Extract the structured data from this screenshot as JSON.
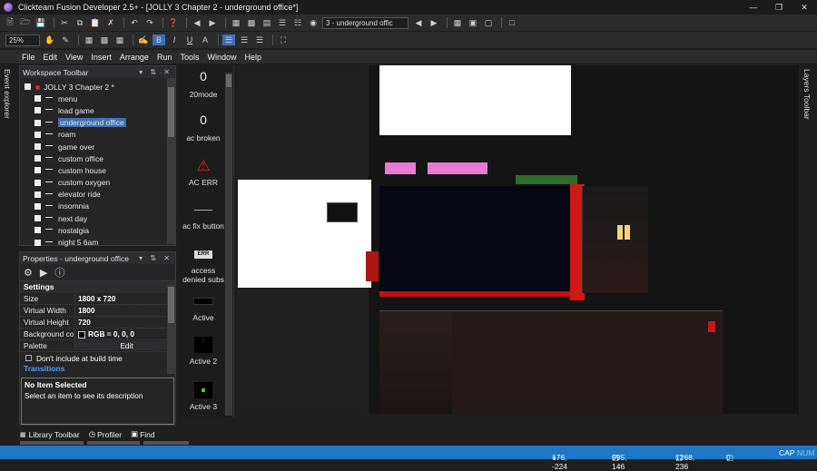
{
  "window": {
    "title": "Clickteam Fusion Developer 2.5+ - [JOLLY 3 Chapter 2 - underground office*]"
  },
  "toolbar": {
    "zoom": "25%",
    "frame_combo": "3 - underground offic"
  },
  "menu": [
    "File",
    "Edit",
    "View",
    "Insert",
    "Arrange",
    "Run",
    "Tools",
    "Window",
    "Help"
  ],
  "left_tabs": {
    "event_explorer": "Event explorer"
  },
  "right_tabs": {
    "layers": "Layers Toolbar"
  },
  "workspace": {
    "title": "Workspace Toolbar",
    "root": "JOLLY 3 Chapter 2 *",
    "frames": [
      "menu",
      "load game",
      "underground office",
      "roam",
      "game over",
      "custom office",
      "custom house",
      "custom oxygen",
      "elevator ride",
      "insomnia",
      "next day",
      "nostalgia",
      "night 5 6am"
    ],
    "selected_index": 2
  },
  "properties": {
    "title": "Properties - underground office",
    "section": "Settings",
    "rows": [
      {
        "key": "Size",
        "value": "1800 x 720"
      },
      {
        "key": "Virtual Width",
        "value": "1800"
      },
      {
        "key": "Virtual Height",
        "value": "720"
      },
      {
        "key": "Background co",
        "value": "RGB = 0, 0, 0"
      },
      {
        "key": "Palette",
        "value": "Edit"
      }
    ],
    "checkbox_label": "Don't include at build time",
    "transitions": "Transitions",
    "desc_title": "No Item Selected",
    "desc_text": "Select an item to see its description"
  },
  "objects": [
    {
      "label": "20mode",
      "icon": "0"
    },
    {
      "label": "ac broken",
      "icon": "0"
    },
    {
      "label": "AC ERR",
      "icon": "warning"
    },
    {
      "label": "ac fix button",
      "icon": "line"
    },
    {
      "label": "access denied subs",
      "icon": "ERR"
    },
    {
      "label": "Active",
      "icon": "box"
    },
    {
      "label": "Active 2",
      "icon": "dots"
    },
    {
      "label": "Active 3",
      "icon": "green"
    }
  ],
  "bottom_tabs": [
    "Library Toolbar",
    "Profiler",
    "Find"
  ],
  "status": {
    "mouse": "176, -224",
    "a": "995, 146",
    "b": "1268, 236",
    "c": "0",
    "cap": "CAP",
    "num": "NUM"
  }
}
